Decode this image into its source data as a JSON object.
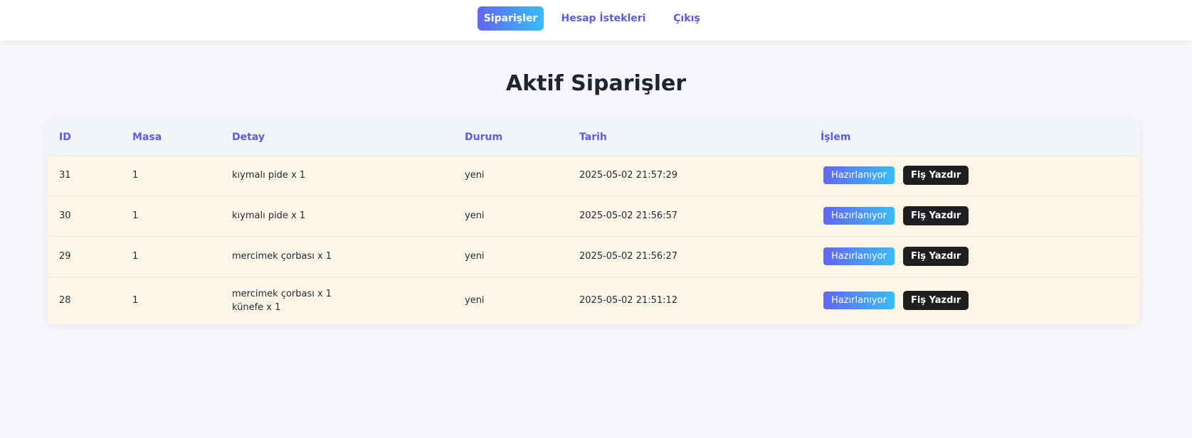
{
  "nav": {
    "items": [
      {
        "label": "Siparişler",
        "active": true
      },
      {
        "label": "Hesap İstekleri",
        "active": false
      },
      {
        "label": "Çıkış",
        "active": false
      }
    ]
  },
  "page": {
    "title": "Aktif Siparişler"
  },
  "table": {
    "columns": [
      "ID",
      "Masa",
      "Detay",
      "Durum",
      "Tarih",
      "İşlem"
    ],
    "rows": [
      {
        "id": "31",
        "masa": "1",
        "detay": [
          "kıymalı pide x 1"
        ],
        "durum": "yeni",
        "tarih": "2025-05-02 21:57:29"
      },
      {
        "id": "30",
        "masa": "1",
        "detay": [
          "kıymalı pide x 1"
        ],
        "durum": "yeni",
        "tarih": "2025-05-02 21:56:57"
      },
      {
        "id": "29",
        "masa": "1",
        "detay": [
          "mercimek çorbası x 1"
        ],
        "durum": "yeni",
        "tarih": "2025-05-02 21:56:27"
      },
      {
        "id": "28",
        "masa": "1",
        "detay": [
          "mercimek çorbası x 1",
          "künefe x 1"
        ],
        "durum": "yeni",
        "tarih": "2025-05-02 21:51:12"
      }
    ],
    "actions": {
      "prepare_label": "Hazırlanıyor",
      "print_label": "Fiş Yazdır"
    }
  },
  "colors": {
    "accent": "#5b5ce2",
    "gradient_start": "#6366f1",
    "gradient_end": "#38bdf8",
    "row_background": "#fdf6e6",
    "print_button": "#1f1f1f"
  }
}
